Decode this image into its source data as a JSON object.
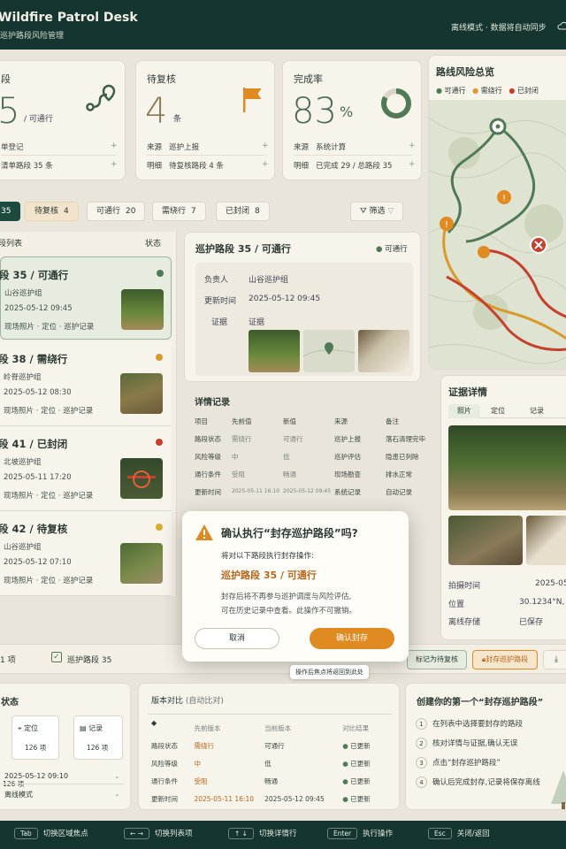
{
  "header": {
    "title": "Wildfire Patrol Desk",
    "subtitle": "巡护路段风险管理",
    "sync_status": "离线模式 · 数据将自动同步"
  },
  "stats": {
    "open": {
      "label": "段",
      "value": "5",
      "suffix": "/ 可通行",
      "row1_a": "单登记",
      "row2_a": "清单路段 35 条"
    },
    "pending": {
      "label": "待复核",
      "value": "4",
      "unit": "条",
      "row1_k": "来源",
      "row1_v": "巡护上报",
      "row2_k": "明细",
      "row2_v": "待复核路段 4 条"
    },
    "completion": {
      "label": "完成率",
      "value": "83",
      "unit": "%",
      "percent": 83,
      "row1_k": "来源",
      "row1_v": "系统计算",
      "row2_k": "明细",
      "row2_v": "已完成 29 / 总路段 35"
    }
  },
  "map": {
    "title": "路线风险总览",
    "legend": [
      "可通行",
      "需绕行",
      "已封闭"
    ]
  },
  "filters": {
    "all_count": "35",
    "pending": {
      "label": "待复核",
      "count": "4"
    },
    "open": {
      "label": "可通行",
      "count": "20"
    },
    "detour": {
      "label": "需绕行",
      "count": "7"
    },
    "closed": {
      "label": "已封闭",
      "count": "8"
    },
    "filter_label": "筛选"
  },
  "list": {
    "title": "段列表",
    "status_col": "状态",
    "items": [
      {
        "title": "段 35 / 可通行",
        "team": "山谷巡护组",
        "time": "2025-05-12 09:45",
        "evidence": "现场照片 · 定位 · 巡护记录"
      },
      {
        "title": "段 38 / 需绕行",
        "team": "岭脊巡护组",
        "time": "2025-05-12 08:30",
        "evidence": "现场照片 · 定位 · 巡护记录"
      },
      {
        "title": "段 41 / 已封闭",
        "team": "北坡巡护组",
        "time": "2025-05-11 17:20",
        "evidence": "现场照片 · 定位 · 巡护记录"
      },
      {
        "title": "段 42 / 待复核",
        "team": "山谷巡护组",
        "time": "2025-05-12 07:10",
        "evidence": "现场照片 · 定位 · 巡护记录"
      }
    ]
  },
  "detail": {
    "title": "巡护路段 35 / 可通行",
    "status": "可通行",
    "owner_k": "负责人",
    "owner_v": "山谷巡护组",
    "updated_k": "更新时间",
    "updated_v": "2025-05-12 09:45",
    "evidence_k": "证据",
    "evidence_v": "证据",
    "records_title": "详情记录",
    "headers": [
      "项目",
      "先前值",
      "新值",
      "来源",
      "备注"
    ],
    "rows": [
      [
        "路段状态",
        "需绕行",
        "可通行",
        "巡护上报",
        "落石清理完毕"
      ],
      [
        "风险等级",
        "中",
        "低",
        "巡护评估",
        "隐患已列除"
      ],
      [
        "通行条件",
        "受阻",
        "畅通",
        "现场勘查",
        "排水正常"
      ],
      [
        "更新时间",
        "2025-05-11 16:10",
        "2025-05-12 09:45",
        "系统记录",
        "自动记录"
      ]
    ]
  },
  "evidence": {
    "title": "证据详情",
    "tabs": [
      "照片",
      "定位",
      "记录"
    ],
    "time_k": "拍摄时间",
    "time_v": "2025-05",
    "loc_k": "位置",
    "loc_v": "30.1234°N, 1",
    "store_k": "离线存储",
    "store_v": "已保存"
  },
  "dialog": {
    "title": "确认执行“封存巡护路段”吗?",
    "intro": "将对以下路段执行封存操作:",
    "target": "巡护路段 35 / 可通行",
    "desc1": "封存后将不再参与巡护调度与风险评估,",
    "desc2": "可在历史记录中查看。此操作不可撤销。",
    "cancel": "取消",
    "confirm": "确认封存",
    "focus_hint": "操作后焦点将返回到此处"
  },
  "actionbar": {
    "count": "1 项",
    "selected": "巡护路段 35",
    "mark_pending": "标记为待复核",
    "archive": "封存巡护路段"
  },
  "status_panel": {
    "title": "状态",
    "loc": "定位",
    "loc_count": "126 项",
    "rec": "记录",
    "rec_count": "126 项",
    "left_count": "126 项",
    "time": "2025-05-12 09:10",
    "mode": "离线模式"
  },
  "version": {
    "title": "版本对比",
    "auto": "(自动比对)",
    "headers": [
      "先前版本",
      "当前版本",
      "对比结果"
    ],
    "rows": [
      [
        "路段状态",
        "需绕行",
        "可通行",
        "已更新"
      ],
      [
        "风险等级",
        "中",
        "低",
        "已更新"
      ],
      [
        "通行条件",
        "受阻",
        "畅通",
        "已更新"
      ],
      [
        "更新时间",
        "2025-05-11 16:10",
        "2025-05-12 09:45",
        "已更新"
      ]
    ]
  },
  "guide": {
    "title": "创建你的第一个“封存巡护路段”",
    "steps": [
      "在列表中选择要封存的路段",
      "核对详情与证据,确认无误",
      "点击“封存巡护路段”",
      "确认后完成封存,记录将保存离线"
    ]
  },
  "shortcuts": [
    {
      "key": "Tab",
      "label": "切换区域焦点"
    },
    {
      "key": "←  →",
      "label": "切换列表项"
    },
    {
      "key": "↑  ↓",
      "label": "切换详情行"
    },
    {
      "key": "Enter",
      "label": "执行操作"
    },
    {
      "key": "Esc",
      "label": "关闭/返回"
    }
  ],
  "colors": {
    "open": "#4f7a55",
    "detour": "#d99a2b",
    "closed": "#c6402e",
    "primary": "#1c4a3f",
    "accent": "#e08a22"
  }
}
